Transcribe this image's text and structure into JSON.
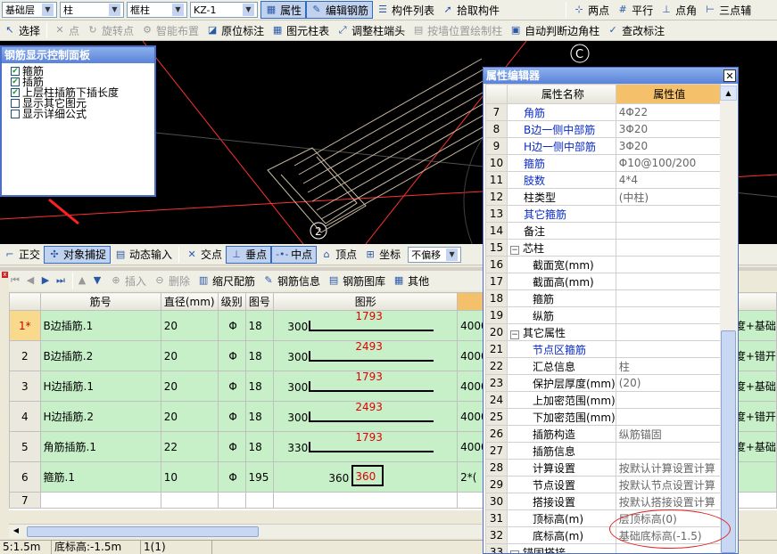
{
  "toolbar1": {
    "floor": "基础层",
    "type": "柱",
    "subtype": "框柱",
    "comp": "KZ-1",
    "attr": "属性",
    "edit": "编辑钢筋",
    "list": "构件列表",
    "pick": "拾取构件",
    "two_point": "两点",
    "parallel": "平行",
    "point_angle": "点角",
    "three_point": "三点辅"
  },
  "toolbar2": {
    "select": "选择",
    "point": "点",
    "rotate": "旋转点",
    "smart": "智能布置",
    "origin": "原位标注",
    "table": "图元柱表",
    "adjust": "调整柱端头",
    "wall": "按墙位置绘制柱",
    "auto": "自动判断边角柱",
    "check": "查改标注"
  },
  "viewport": {
    "marker2": "2",
    "markerC": "C"
  },
  "panel": {
    "title": "钢筋显示控制面板",
    "items": [
      {
        "label": "箍筋",
        "checked": true
      },
      {
        "label": "插筋",
        "checked": true
      },
      {
        "label": "上层柱插筋下插长度",
        "checked": true
      },
      {
        "label": "显示其它图元",
        "checked": false
      },
      {
        "label": "显示详细公式",
        "checked": false
      }
    ]
  },
  "snap": {
    "ortho": "正交",
    "snap": "对象捕捉",
    "dyn": "动态输入",
    "inter": "交点",
    "perp": "垂点",
    "mid": "中点",
    "vertex": "顶点",
    "coord": "坐标",
    "offset": "不偏移"
  },
  "gridbar": {
    "insert": "插入",
    "delete": "删除",
    "scale": "缩尺配筋",
    "info": "钢筋信息",
    "lib": "钢筋图库",
    "other": "其他"
  },
  "grid": {
    "headers": [
      "筋号",
      "直径(mm)",
      "级别",
      "图号",
      "图形"
    ],
    "rows": [
      {
        "no": "1*",
        "name": "B边插筋.1",
        "dia": "20",
        "grade": "Φ",
        "fig": "18",
        "left": "300",
        "len": "1793",
        "tail": "4000",
        "extra": "长度+基础"
      },
      {
        "no": "2",
        "name": "B边插筋.2",
        "dia": "20",
        "grade": "Φ",
        "fig": "18",
        "left": "300",
        "len": "2493",
        "tail": "4000",
        "extra": "长度+错开"
      },
      {
        "no": "3",
        "name": "H边插筋.1",
        "dia": "20",
        "grade": "Φ",
        "fig": "18",
        "left": "300",
        "len": "1793",
        "tail": "4000",
        "extra": "长度+基础"
      },
      {
        "no": "4",
        "name": "H边插筋.2",
        "dia": "20",
        "grade": "Φ",
        "fig": "18",
        "left": "300",
        "len": "2493",
        "tail": "4000",
        "extra": "长度+错开"
      },
      {
        "no": "5",
        "name": "角筋插筋.1",
        "dia": "22",
        "grade": "Φ",
        "fig": "18",
        "left": "330",
        "len": "1793",
        "tail": "4000",
        "extra": "长度+基础"
      },
      {
        "no": "6",
        "name": "箍筋.1",
        "dia": "10",
        "grade": "Φ",
        "fig": "195",
        "left": "360",
        "len": "360",
        "tail": "2*(",
        "extra": ""
      },
      {
        "no": "7",
        "name": "",
        "dia": "",
        "grade": "",
        "fig": "",
        "left": "",
        "len": "",
        "tail": "",
        "extra": ""
      }
    ]
  },
  "status": {
    "a": "5:1.5m",
    "b": "底标高:-1.5m",
    "c": "1(1)"
  },
  "prop": {
    "title": "属性编辑器",
    "h1": "属性名称",
    "h2": "属性值",
    "rows": [
      {
        "n": "7",
        "name": "角筋",
        "val": "4Φ22",
        "blue": true
      },
      {
        "n": "8",
        "name": "B边一侧中部筋",
        "val": "3Φ20",
        "blue": true
      },
      {
        "n": "9",
        "name": "H边一侧中部筋",
        "val": "3Φ20",
        "blue": true
      },
      {
        "n": "10",
        "name": "箍筋",
        "val": "Φ10@100/200",
        "blue": true
      },
      {
        "n": "11",
        "name": "肢数",
        "val": "4*4",
        "blue": true
      },
      {
        "n": "12",
        "name": "柱类型",
        "val": "(中柱)",
        "blue": false
      },
      {
        "n": "13",
        "name": "其它箍筋",
        "val": "",
        "blue": true
      },
      {
        "n": "14",
        "name": "备注",
        "val": "",
        "blue": false
      },
      {
        "n": "15",
        "name": "芯柱",
        "val": "",
        "blue": false,
        "group": true
      },
      {
        "n": "16",
        "name": "截面宽(mm)",
        "val": "",
        "blue": false,
        "ind": true
      },
      {
        "n": "17",
        "name": "截面高(mm)",
        "val": "",
        "blue": false,
        "ind": true
      },
      {
        "n": "18",
        "name": "箍筋",
        "val": "",
        "blue": false,
        "ind": true
      },
      {
        "n": "19",
        "name": "纵筋",
        "val": "",
        "blue": false,
        "ind": true
      },
      {
        "n": "20",
        "name": "其它属性",
        "val": "",
        "blue": false,
        "group": true
      },
      {
        "n": "21",
        "name": "节点区箍筋",
        "val": "",
        "blue": true,
        "ind": true
      },
      {
        "n": "22",
        "name": "汇总信息",
        "val": "柱",
        "blue": false,
        "ind": true
      },
      {
        "n": "23",
        "name": "保护层厚度(mm)",
        "val": "(20)",
        "blue": false,
        "ind": true
      },
      {
        "n": "24",
        "name": "上加密范围(mm)",
        "val": "",
        "blue": false,
        "ind": true
      },
      {
        "n": "25",
        "name": "下加密范围(mm)",
        "val": "",
        "blue": false,
        "ind": true
      },
      {
        "n": "26",
        "name": "插筋构造",
        "val": "纵筋锚固",
        "blue": false,
        "ind": true
      },
      {
        "n": "27",
        "name": "插筋信息",
        "val": "",
        "blue": false,
        "ind": true
      },
      {
        "n": "28",
        "name": "计算设置",
        "val": "按默认计算设置计算",
        "blue": false,
        "ind": true
      },
      {
        "n": "29",
        "name": "节点设置",
        "val": "按默认节点设置计算",
        "blue": false,
        "ind": true
      },
      {
        "n": "30",
        "name": "搭接设置",
        "val": "按默认搭接设置计算",
        "blue": false,
        "ind": true
      },
      {
        "n": "31",
        "name": "顶标高(m)",
        "val": "层顶标高(0)",
        "blue": false,
        "ind": true
      },
      {
        "n": "32",
        "name": "底标高(m)",
        "val": "基础底标高(-1.5)",
        "blue": false,
        "ind": true
      },
      {
        "n": "33",
        "name": "锚固搭接",
        "val": "",
        "blue": false,
        "group": true
      }
    ]
  }
}
